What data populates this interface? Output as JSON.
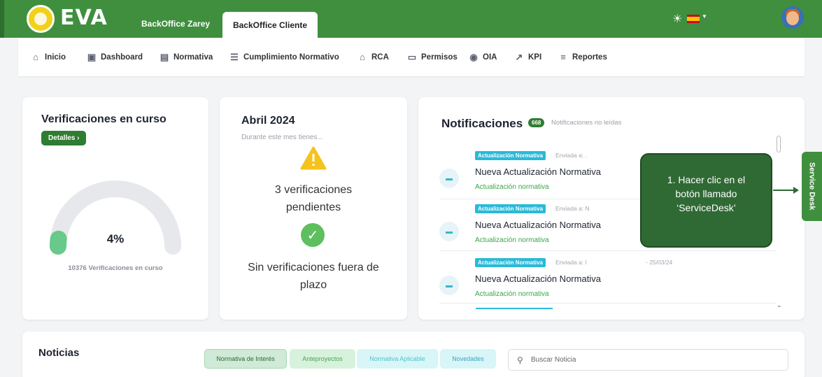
{
  "header": {
    "brand": "EVA",
    "tabs": [
      "BackOffice Zarey",
      "BackOffice Cliente"
    ],
    "active_tab": "BackOffice Cliente",
    "colors": {
      "primary": "#3f8f3f",
      "accent": "#2bb9d8"
    }
  },
  "nav": {
    "items": [
      {
        "label": "Inicio",
        "icon": "home-icon"
      },
      {
        "label": "Dashboard",
        "icon": "dashboard-icon"
      },
      {
        "label": "Normativa",
        "icon": "clipboard-check-icon"
      },
      {
        "label": "Cumplimiento Normativo",
        "icon": "checklist-icon"
      },
      {
        "label": "RCA",
        "icon": "building-icon"
      },
      {
        "label": "Permisos",
        "icon": "document-icon"
      },
      {
        "label": "OIA",
        "icon": "map-pin-icon"
      },
      {
        "label": "KPI",
        "icon": "chart-line-icon"
      },
      {
        "label": "Reportes",
        "icon": "list-icon"
      }
    ]
  },
  "verificaciones": {
    "title": "Verificaciones en curso",
    "details_button": "Detalles",
    "percent": "4%",
    "percent_value": 4,
    "caption": "10376 Verificaciones en curso"
  },
  "abril": {
    "title": "Abril 2024",
    "subtitle": "Durante este mes tienes...",
    "pending": "3 verificaciones pendientes",
    "no_late": "Sin verificaciones fuera de plazo"
  },
  "notificaciones": {
    "title": "Notificaciones",
    "count": "668",
    "count_label": "Notificaciones no leídas",
    "items": [
      {
        "tag": "Actualización Normativa",
        "sent": "Enviada a: .",
        "date": "",
        "title": "Nueva Actualización Normativa",
        "subtitle": "Actualización normativa"
      },
      {
        "tag": "Actualización Normativa",
        "sent": "Enviada a: N",
        "date": "",
        "title": "Nueva Actualización Normativa",
        "subtitle": "Actualización normativa"
      },
      {
        "tag": "Actualización Normativa",
        "sent": "Enviada a: I",
        "date": "- 25/03/24",
        "title": "Nueva Actualización Normativa",
        "subtitle": "Actualización normativa"
      }
    ]
  },
  "callout": {
    "text": "1. Hacer clic en el botón llamado ‘ServiceDesk’"
  },
  "service_desk": {
    "label": "Service Desk"
  },
  "noticias": {
    "title": "Noticias",
    "filters": [
      "Normativa de Interés",
      "Anteproyectos",
      "Normativa Aplicable",
      "Novedades"
    ],
    "search_placeholder": "Buscar Noticia"
  }
}
